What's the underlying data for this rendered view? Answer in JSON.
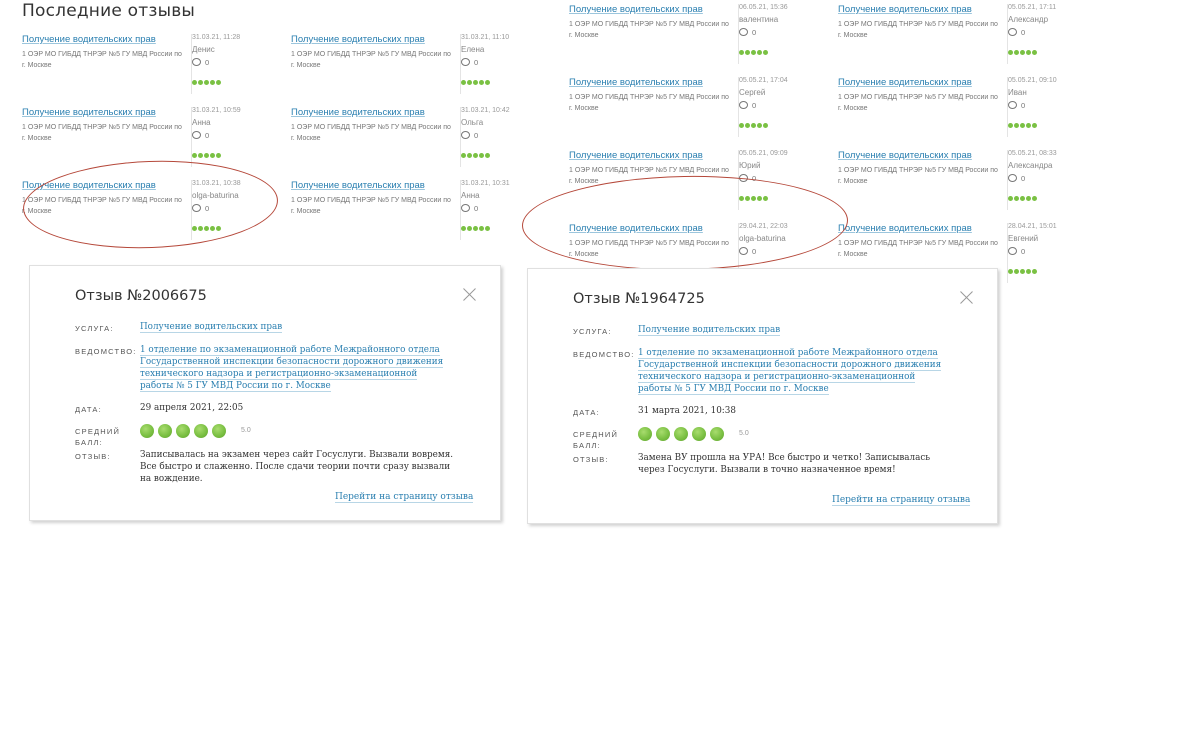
{
  "left_panel": {
    "title": "Последние отзывы",
    "reviews": [
      {
        "service": "Получение водительских прав",
        "org": "1 ОЭР МО ГИБДД ТНРЭР №5 ГУ МВД России по г. Москве",
        "date": "31.03.21, 11:28",
        "author": "Денис",
        "comments": "0"
      },
      {
        "service": "Получение водительских прав",
        "org": "1 ОЭР МО ГИБДД ТНРЭР №5 ГУ МВД России по г. Москве",
        "date": "31.03.21, 11:10",
        "author": "Елена",
        "comments": "0"
      },
      {
        "service": "Получение водительских прав",
        "org": "1 ОЭР МО ГИБДД ТНРЭР №5 ГУ МВД России по г. Москве",
        "date": "31.03.21, 10:59",
        "author": "Анна",
        "comments": "0"
      },
      {
        "service": "Получение водительских прав",
        "org": "1 ОЭР МО ГИБДД ТНРЭР №5 ГУ МВД России по г. Москве",
        "date": "31.03.21, 10:42",
        "author": "Ольга",
        "comments": "0"
      },
      {
        "service": "Получение водительских прав",
        "org": "1 ОЭР МО ГИБДД ТНРЭР №5 ГУ МВД России по г. Москве",
        "date": "31.03.21, 10:38",
        "author": "olga-baturina",
        "comments": "0"
      },
      {
        "service": "Получение водительских прав",
        "org": "1 ОЭР МО ГИБДД ТНРЭР №5 ГУ МВД России по г. Москве",
        "date": "31.03.21, 10:31",
        "author": "Анна",
        "comments": "0"
      }
    ]
  },
  "right_panel": {
    "reviews": [
      {
        "service": "Получение водительских прав",
        "org": "1 ОЭР МО ГИБДД ТНРЭР №5 ГУ МВД России по г. Москве",
        "date": "06.05.21, 15:36",
        "author": "валентина",
        "comments": "0"
      },
      {
        "service": "Получение водительских прав",
        "org": "1 ОЭР МО ГИБДД ТНРЭР №5 ГУ МВД России по г. Москве",
        "date": "05.05.21, 17:11",
        "author": "Александр",
        "comments": "0"
      },
      {
        "service": "Получение водительских прав",
        "org": "1 ОЭР МО ГИБДД ТНРЭР №5 ГУ МВД России по г. Москве",
        "date": "05.05.21, 17:04",
        "author": "Сергей",
        "comments": "0"
      },
      {
        "service": "Получение водительских прав",
        "org": "1 ОЭР МО ГИБДД ТНРЭР №5 ГУ МВД России по г. Москве",
        "date": "05.05.21, 09:10",
        "author": "Иван",
        "comments": "0"
      },
      {
        "service": "Получение водительских прав",
        "org": "1 ОЭР МО ГИБДД ТНРЭР №5 ГУ МВД России по г. Москве",
        "date": "05.05.21, 09:09",
        "author": "Юрий",
        "comments": "0"
      },
      {
        "service": "Получение водительских прав",
        "org": "1 ОЭР МО ГИБДД ТНРЭР №5 ГУ МВД России по г. Москве",
        "date": "05.05.21, 08:33",
        "author": "Александра",
        "comments": "0"
      },
      {
        "service": "Получение водительских прав",
        "org": "1 ОЭР МО ГИБДД ТНРЭР №5 ГУ МВД России по г. Москве",
        "date": "29.04.21, 22:03",
        "author": "olga-baturina",
        "comments": "0"
      },
      {
        "service": "Получение водительских прав",
        "org": "1 ОЭР МО ГИБДД ТНРЭР №5 ГУ МВД России по г. Москве",
        "date": "28.04.21, 15:01",
        "author": "Евгений",
        "comments": "0"
      }
    ]
  },
  "modal_left": {
    "title": "Отзыв №2006675",
    "service_label": "Услуга:",
    "service": "Получение водительских прав",
    "agency_label": "Ведомство:",
    "agency": "1 отделение по экзаменационной работе Межрайонного отдела Государственной инспекции безопасности дорожного движения технического надзора и регистрационно-экзаменационной работы № 5 ГУ МВД России по г. Москве",
    "date_label": "Дата:",
    "date": "29 апреля 2021, 22:05",
    "rating_label": "Средний балл:",
    "rating": "5.0",
    "rating_value": 5,
    "review_label": "Отзыв:",
    "review": "Записывалась на экзамен через сайт Госуслуги. Вызвали вовремя. Все быстро и слаженно. После сдачи теории почти сразу вызвали на вождение.",
    "link": "Перейти на страницу отзыва"
  },
  "modal_right": {
    "title": "Отзыв №1964725",
    "service_label": "Услуга:",
    "service": "Получение водительских прав",
    "agency_label": "Ведомство:",
    "agency": "1 отделение по экзаменационной работе Межрайонного отдела Государственной инспекции безопасности дорожного движения технического надзора и регистрационно-экзаменационной работы № 5 ГУ МВД России по г. Москве",
    "date_label": "Дата:",
    "date": "31 марта 2021, 10:38",
    "rating_label": "Средний балл:",
    "rating": "5.0",
    "rating_value": 5,
    "review_label": "Отзыв:",
    "review": "Замена ВУ прошла на УРА! Все быстро и четко! Записывалась через Госуслуги. Вызвали в точно назначенное время!",
    "link": "Перейти на страницу отзыва"
  },
  "colors": {
    "link": "#2a7fb0",
    "stars": "#7ac143",
    "highlight": "#b5483a"
  }
}
